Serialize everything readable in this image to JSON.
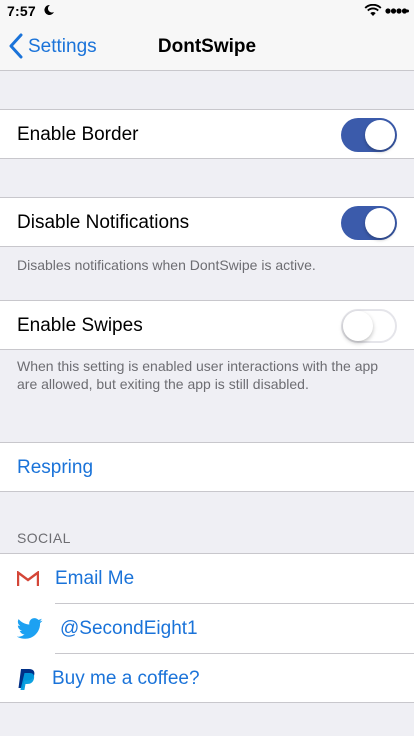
{
  "status_bar": {
    "time": "7:57"
  },
  "nav": {
    "back_label": "Settings",
    "title": "DontSwipe"
  },
  "settings": {
    "enable_border": {
      "label": "Enable Border",
      "on": true
    },
    "disable_notifications": {
      "label": "Disable Notifications",
      "on": true,
      "footer": "Disables notifications when DontSwipe is active."
    },
    "enable_swipes": {
      "label": "Enable Swipes",
      "on": false,
      "footer": "When this setting is enabled user interactions with the app are allowed, but exiting the app is still disabled."
    },
    "respring": {
      "label": "Respring"
    }
  },
  "social": {
    "header": "SOCIAL",
    "items": [
      {
        "label": "Email Me",
        "icon": "gmail-icon"
      },
      {
        "label": "@SecondEight1",
        "icon": "twitter-icon"
      },
      {
        "label": "Buy me a coffee?",
        "icon": "paypal-icon"
      }
    ]
  },
  "colors": {
    "accent": "#1a73d9",
    "toggle_on": "#3b5bab",
    "background": "#efeff4"
  }
}
